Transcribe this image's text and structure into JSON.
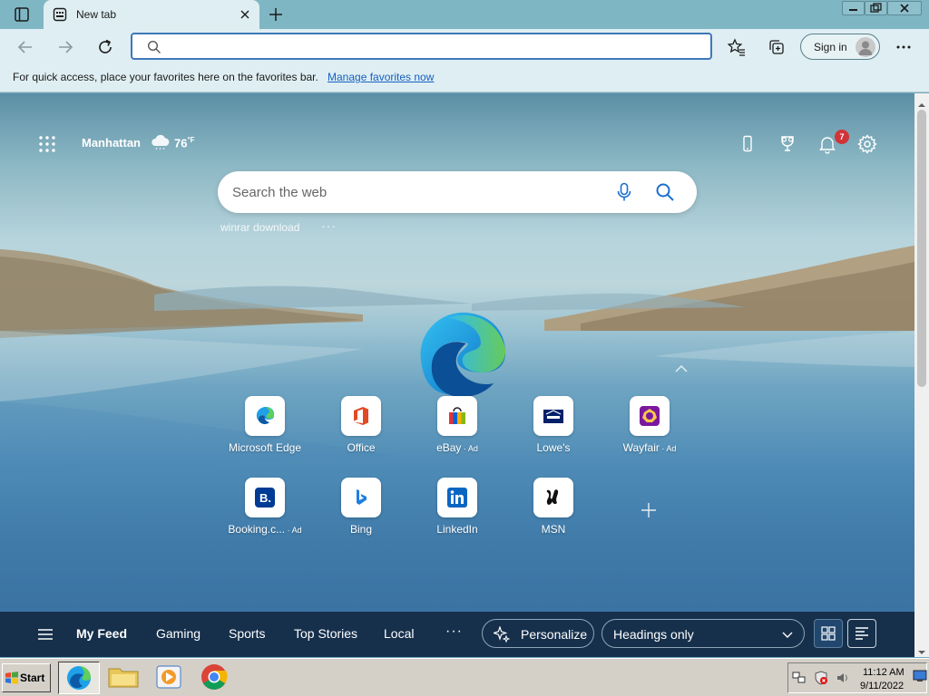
{
  "browser": {
    "tab": {
      "title": "New tab"
    },
    "address_bar": {
      "value": "",
      "placeholder": ""
    },
    "sign_in_label": "Sign in"
  },
  "favorites_bar": {
    "message": "For quick access, place your favorites here on the favorites bar.",
    "link": "Manage favorites now"
  },
  "newtab": {
    "weather": {
      "city": "Manhattan",
      "temp": "76",
      "unit": "°F"
    },
    "notifications_count": "7",
    "search": {
      "placeholder": "Search the web",
      "trending": "winrar download",
      "trending_more": "···"
    },
    "quick_links": [
      {
        "label": "Microsoft Edge",
        "ad": "",
        "icon": "edge-icon"
      },
      {
        "label": "Office",
        "ad": "",
        "icon": "office-icon"
      },
      {
        "label": "eBay",
        "ad": " · Ad",
        "icon": "ebay-icon"
      },
      {
        "label": "Lowe's",
        "ad": "",
        "icon": "lowes-icon"
      },
      {
        "label": "Wayfair",
        "ad": " · Ad",
        "icon": "wayfair-icon"
      },
      {
        "label": "Booking.c...",
        "ad": " · Ad",
        "icon": "booking-icon"
      },
      {
        "label": "Bing",
        "ad": "",
        "icon": "bing-icon"
      },
      {
        "label": "LinkedIn",
        "ad": "",
        "icon": "linkedin-icon"
      },
      {
        "label": "MSN",
        "ad": "",
        "icon": "msn-icon"
      }
    ],
    "feed_nav": {
      "tabs": [
        "My Feed",
        "Gaming",
        "Sports",
        "Top Stories",
        "Local"
      ],
      "more": "···",
      "personalize": "Personalize",
      "headings_select": "Headings only"
    }
  },
  "taskbar": {
    "start_label": "Start",
    "clock": {
      "time": "11:12 AM",
      "date": "9/11/2022"
    }
  },
  "colors": {
    "accent": "#3d78b8",
    "feed_bar": "#16304c",
    "notification": "#d13438"
  }
}
